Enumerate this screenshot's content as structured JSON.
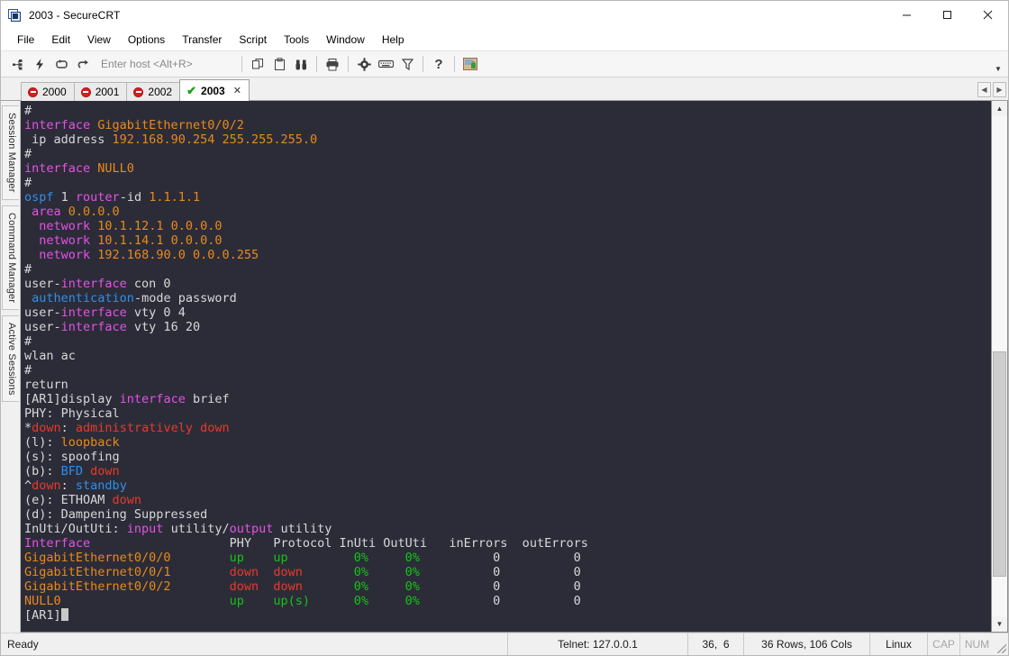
{
  "window": {
    "title": "2003 - SecureCRT",
    "icon": "securecrt-app-icon",
    "minimize": "minimize-icon",
    "maximize": "maximize-icon",
    "close": "close-icon"
  },
  "menu": {
    "items": [
      {
        "label": "File"
      },
      {
        "label": "Edit"
      },
      {
        "label": "View"
      },
      {
        "label": "Options"
      },
      {
        "label": "Transfer"
      },
      {
        "label": "Script"
      },
      {
        "label": "Tools"
      },
      {
        "label": "Window"
      },
      {
        "label": "Help"
      }
    ]
  },
  "toolbar": {
    "host_placeholder": "Enter host <Alt+R>",
    "icons": [
      "connect-icon",
      "quick-connect-icon",
      "reconnect-icon",
      "disconnect-icon",
      "copy-icon",
      "paste-icon",
      "find-icon",
      "print-icon",
      "settings-gear-icon",
      "keyboard-icon",
      "filter-icon",
      "help-icon",
      "secure-session-icon"
    ],
    "overflow": "chevron-down-icon"
  },
  "tabs": {
    "items": [
      {
        "label": "2000",
        "status": "disconnected",
        "active": false
      },
      {
        "label": "2001",
        "status": "disconnected",
        "active": false
      },
      {
        "label": "2002",
        "status": "disconnected",
        "active": false
      },
      {
        "label": "2003",
        "status": "connected",
        "active": true
      }
    ],
    "close_label": "✕",
    "nav_prev": "◀",
    "nav_next": "▶"
  },
  "sidebar": {
    "items": [
      {
        "label": "Session Manager"
      },
      {
        "label": "Command Manager"
      },
      {
        "label": "Active Sessions"
      }
    ]
  },
  "terminal": {
    "lines": [
      [
        {
          "t": "#",
          "c": "c-w"
        }
      ],
      [
        {
          "t": "interface ",
          "c": "c-m"
        },
        {
          "t": "GigabitEthernet0/0/2",
          "c": "c-o"
        }
      ],
      [
        {
          "t": " ip address ",
          "c": "c-w"
        },
        {
          "t": "192.168.90.254 255.255.255.0",
          "c": "c-o"
        }
      ],
      [
        {
          "t": "#",
          "c": "c-w"
        }
      ],
      [
        {
          "t": "interface ",
          "c": "c-m"
        },
        {
          "t": "NULL0",
          "c": "c-o"
        }
      ],
      [
        {
          "t": "#",
          "c": "c-w"
        }
      ],
      [
        {
          "t": "ospf",
          "c": "c-b"
        },
        {
          "t": " 1 ",
          "c": "c-w"
        },
        {
          "t": "router",
          "c": "c-m"
        },
        {
          "t": "-id ",
          "c": "c-w"
        },
        {
          "t": "1.1.1.1",
          "c": "c-o"
        }
      ],
      [
        {
          "t": " ",
          "c": "c-w"
        },
        {
          "t": "area ",
          "c": "c-m"
        },
        {
          "t": "0.0.0.0",
          "c": "c-o"
        }
      ],
      [
        {
          "t": "  ",
          "c": "c-w"
        },
        {
          "t": "network ",
          "c": "c-m"
        },
        {
          "t": "10.1.12.1 0.0.0.0",
          "c": "c-o"
        }
      ],
      [
        {
          "t": "  ",
          "c": "c-w"
        },
        {
          "t": "network ",
          "c": "c-m"
        },
        {
          "t": "10.1.14.1 0.0.0.0",
          "c": "c-o"
        }
      ],
      [
        {
          "t": "  ",
          "c": "c-w"
        },
        {
          "t": "network ",
          "c": "c-m"
        },
        {
          "t": "192.168.90.0 0.0.0.255",
          "c": "c-o"
        }
      ],
      [
        {
          "t": "#",
          "c": "c-w"
        }
      ],
      [
        {
          "t": "user-",
          "c": "c-w"
        },
        {
          "t": "interface",
          "c": "c-m"
        },
        {
          "t": " con 0",
          "c": "c-w"
        }
      ],
      [
        {
          "t": " ",
          "c": "c-w"
        },
        {
          "t": "authentication",
          "c": "c-b"
        },
        {
          "t": "-mode password",
          "c": "c-w"
        }
      ],
      [
        {
          "t": "user-",
          "c": "c-w"
        },
        {
          "t": "interface",
          "c": "c-m"
        },
        {
          "t": " vty 0 4",
          "c": "c-w"
        }
      ],
      [
        {
          "t": "user-",
          "c": "c-w"
        },
        {
          "t": "interface",
          "c": "c-m"
        },
        {
          "t": " vty 16 20",
          "c": "c-w"
        }
      ],
      [
        {
          "t": "#",
          "c": "c-w"
        }
      ],
      [
        {
          "t": "wlan ac",
          "c": "c-w"
        }
      ],
      [
        {
          "t": "#",
          "c": "c-w"
        }
      ],
      [
        {
          "t": "return",
          "c": "c-w"
        }
      ],
      [
        {
          "t": "[AR1]display ",
          "c": "c-w"
        },
        {
          "t": "interface",
          "c": "c-m"
        },
        {
          "t": " brief",
          "c": "c-w"
        }
      ],
      [
        {
          "t": "PHY: Physical",
          "c": "c-w"
        }
      ],
      [
        {
          "t": "*",
          "c": "c-w"
        },
        {
          "t": "down",
          "c": "c-r"
        },
        {
          "t": ": ",
          "c": "c-w"
        },
        {
          "t": "administratively down",
          "c": "c-r"
        }
      ],
      [
        {
          "t": "(l): ",
          "c": "c-w"
        },
        {
          "t": "loopback",
          "c": "c-o"
        }
      ],
      [
        {
          "t": "(s): spoofing",
          "c": "c-w"
        }
      ],
      [
        {
          "t": "(b): ",
          "c": "c-w"
        },
        {
          "t": "BFD",
          "c": "c-b"
        },
        {
          "t": " ",
          "c": "c-w"
        },
        {
          "t": "down",
          "c": "c-r"
        }
      ],
      [
        {
          "t": "^",
          "c": "c-w"
        },
        {
          "t": "down",
          "c": "c-r"
        },
        {
          "t": ": ",
          "c": "c-w"
        },
        {
          "t": "standby",
          "c": "c-b"
        }
      ],
      [
        {
          "t": "(e): ETHOAM ",
          "c": "c-w"
        },
        {
          "t": "down",
          "c": "c-r"
        }
      ],
      [
        {
          "t": "(d): Dampening Suppressed",
          "c": "c-w"
        }
      ],
      [
        {
          "t": "InUti/OutUti: ",
          "c": "c-w"
        },
        {
          "t": "input",
          "c": "c-m"
        },
        {
          "t": " utility/",
          "c": "c-w"
        },
        {
          "t": "output",
          "c": "c-m"
        },
        {
          "t": " utility",
          "c": "c-w"
        }
      ],
      [
        {
          "t": "Interface                   ",
          "c": "c-m"
        },
        {
          "t": "PHY   Protocol InUti OutUti   inErrors  outErrors",
          "c": "c-w"
        }
      ],
      [
        {
          "t": "GigabitEthernet0/0/0        ",
          "c": "c-o"
        },
        {
          "t": "up    up         ",
          "c": "c-g"
        },
        {
          "t": "0%     0%",
          "c": "c-g"
        },
        {
          "t": "          0          0",
          "c": "c-w"
        }
      ],
      [
        {
          "t": "GigabitEthernet0/0/1        ",
          "c": "c-o"
        },
        {
          "t": "down  down       ",
          "c": "c-r"
        },
        {
          "t": "0%     0%",
          "c": "c-g"
        },
        {
          "t": "          0          0",
          "c": "c-w"
        }
      ],
      [
        {
          "t": "GigabitEthernet0/0/2        ",
          "c": "c-o"
        },
        {
          "t": "down  down       ",
          "c": "c-r"
        },
        {
          "t": "0%     0%",
          "c": "c-g"
        },
        {
          "t": "          0          0",
          "c": "c-w"
        }
      ],
      [
        {
          "t": "NULL0                       ",
          "c": "c-o"
        },
        {
          "t": "up    up(s)     ",
          "c": "c-g"
        },
        {
          "t": " 0%     0%",
          "c": "c-g"
        },
        {
          "t": "          0          0",
          "c": "c-w"
        }
      ],
      [
        {
          "t": "[AR1]",
          "c": "c-w"
        },
        {
          "cursor": true
        }
      ]
    ],
    "colors": {
      "background": "#2c2c39",
      "foreground": "#d8d8d8",
      "magenta": "#e452e4",
      "orange": "#e88a1a",
      "blue": "#2f8fe8",
      "red": "#e83a27",
      "green": "#14c414"
    }
  },
  "statusbar": {
    "ready": "Ready",
    "protocol": "Telnet: 127.0.0.1",
    "cursor_pos": "36,  6",
    "dimensions": "36 Rows, 106 Cols",
    "emulation": "Linux",
    "caps": "CAP",
    "num": "NUM"
  }
}
